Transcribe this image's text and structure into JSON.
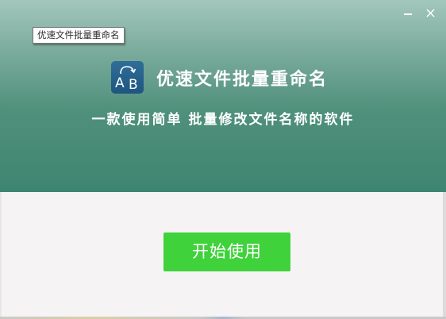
{
  "window": {
    "tooltip_text": "优速文件批量重命名",
    "minimize_icon": "minimize-icon",
    "close_icon": "close-icon"
  },
  "header": {
    "logo_icon": "ab-rename-logo-icon",
    "logo_letters": [
      "A",
      "B"
    ],
    "title": "优速文件批量重命名",
    "subtitle": "一款使用简单 批量修改文件名称的软件"
  },
  "main": {
    "start_button_label": "开始使用"
  },
  "colors": {
    "header_top": "#a3c7bd",
    "header_bottom": "#3e8570",
    "logo_bg": "#1e5680",
    "content_bg": "#f5f3f4",
    "start_button_bg": "#3fd23b"
  }
}
